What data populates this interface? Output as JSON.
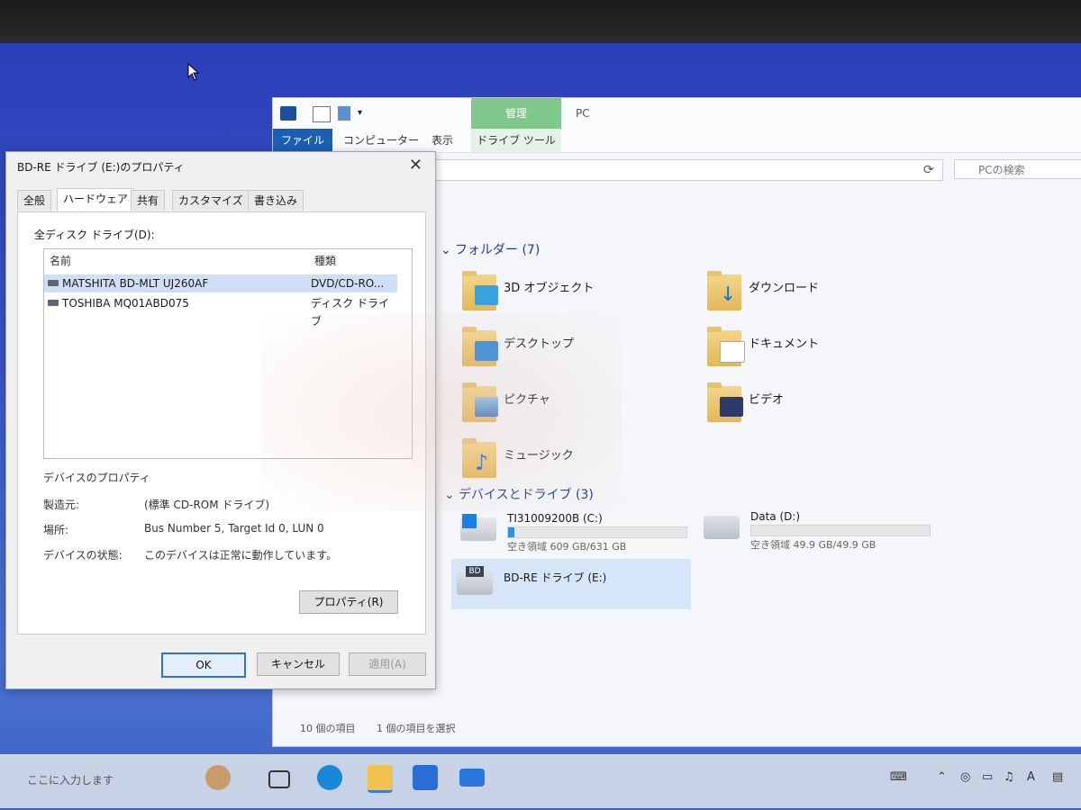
{
  "explorer": {
    "title": "PC",
    "ribbon_manage": "管理",
    "tabs": [
      "ファイル",
      "コンピューター",
      "表示",
      "ドライブ ツール"
    ],
    "search_placeholder": "PCの検索",
    "groups": {
      "folders": "フォルダー (7)",
      "devices": "デバイスとドライブ (3)"
    },
    "folders": [
      "3D オブジェクト",
      "ダウンロード",
      "デスクトップ",
      "ドキュメント",
      "ピクチャ",
      "ビデオ",
      "ミュージック"
    ],
    "drives": [
      {
        "name": "TI31009200B (C:)",
        "free": "空き領域 609 GB/631 GB",
        "used_fraction": 0.035
      },
      {
        "name": "Data (D:)",
        "free": "空き領域 49.9 GB/49.9 GB",
        "used_fraction": 0.0
      },
      {
        "name": "BD-RE ドライブ (E:)",
        "badge": "BD"
      }
    ],
    "status": {
      "items": "10 個の項目",
      "selected": "1 個の項目を選択"
    }
  },
  "dialog": {
    "title": "BD-RE ドライブ (E:)のプロパティ",
    "tabs": [
      "全般",
      "ハードウェア",
      "共有",
      "カスタマイズ",
      "書き込み"
    ],
    "all_drives_label": "全ディスク ドライブ(D):",
    "columns": {
      "name": "名前",
      "type": "種類"
    },
    "rows": [
      {
        "name": "MATSHITA BD-MLT UJ260AF",
        "type": "DVD/CD-RO..."
      },
      {
        "name": "TOSHIBA MQ01ABD075",
        "type": "ディスク ドライブ"
      }
    ],
    "device_props_label": "デバイスのプロパティ",
    "props": [
      {
        "label": "製造元:",
        "value": "(標準 CD-ROM ドライブ)"
      },
      {
        "label": "場所:",
        "value": "Bus Number 5, Target Id 0, LUN 0"
      },
      {
        "label": "デバイスの状態:",
        "value": "このデバイスは正常に動作しています。"
      }
    ],
    "properties_button": "プロパティ(R)",
    "ok": "OK",
    "cancel": "キャンセル",
    "apply": "適用(A)"
  },
  "taskbar": {
    "search": "ここに入力します"
  }
}
